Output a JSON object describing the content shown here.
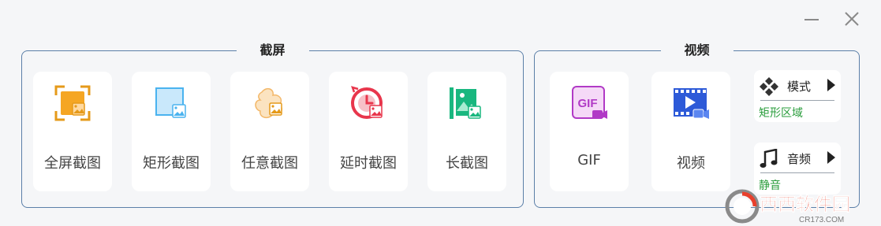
{
  "window": {
    "minimize_icon": "minimize-icon",
    "close_icon": "close-icon"
  },
  "screenshot_group": {
    "title": "截屏",
    "items": [
      {
        "label": "全屏截图",
        "icon": "fullscreen-capture-icon",
        "color": "#f5a623"
      },
      {
        "label": "矩形截图",
        "icon": "rect-capture-icon",
        "color": "#4ab3ef"
      },
      {
        "label": "任意截图",
        "icon": "freeform-capture-icon",
        "color": "#f3b86a"
      },
      {
        "label": "延时截图",
        "icon": "delay-capture-icon",
        "color": "#e8364c"
      },
      {
        "label": "长截图",
        "icon": "long-capture-icon",
        "color": "#19b77f"
      }
    ]
  },
  "video_group": {
    "title": "视频",
    "items": [
      {
        "label": "GIF",
        "icon": "gif-record-icon",
        "icon_text": "GIF",
        "color": "#b13ac6"
      },
      {
        "label": "视频",
        "icon": "video-record-icon",
        "color": "#2d5ad8"
      }
    ],
    "mode": {
      "label": "模式",
      "value": "矩形区域",
      "icon": "mode-icon"
    },
    "audio": {
      "label": "音频",
      "value": "静音",
      "icon": "music-note-icon"
    }
  },
  "watermark": {
    "text": "西西软件园",
    "subtext": "CR173.COM",
    "icon": "site-logo"
  },
  "colors": {
    "background": "#f5f6f8",
    "border": "#5b7fa8",
    "option_value": "#2a9d3c"
  }
}
